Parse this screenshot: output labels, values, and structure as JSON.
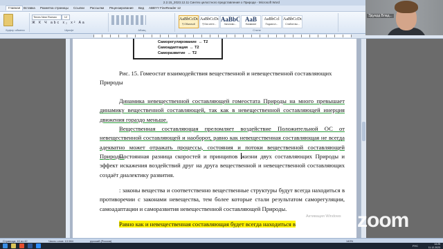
{
  "window": {
    "title": "2.2.15_2023.12.11 Синтез целостного представления о Природе - Microsoft Word",
    "controls": "— □ ✕"
  },
  "tabs": [
    "Главная",
    "Вставка",
    "Разметка страницы",
    "Ссылки",
    "Рассылки",
    "Рецензирование",
    "Вид",
    "ABBYY FineReader 12"
  ],
  "ribbon": {
    "font_name": "Times New Roman",
    "font_size": "12",
    "format_buttons": "Ж К Ч abc x₂ x² Aa",
    "groups": [
      "Буфер обмена",
      "Шрифт",
      "Абзац",
      "Стили",
      "Редактирование"
    ],
    "styles": [
      {
        "sample": "AaBbCcDc",
        "name": "¶ Обычный"
      },
      {
        "sample": "AaBbCcDc",
        "name": "¶ Без инте..."
      },
      {
        "sample": "AaBbC",
        "name": "Заголово..."
      },
      {
        "sample": "AaB",
        "name": "Название"
      },
      {
        "sample": "AaBbCcl",
        "name": "Подзагол..."
      },
      {
        "sample": "AaBbCcDc",
        "name": "Слабое вы..."
      }
    ],
    "edit_items": [
      "Найти ▾",
      "Заменить",
      "Выделить ▾"
    ]
  },
  "figure": {
    "rows": [
      {
        "label": "Саморегулирование",
        "arrow": "↔",
        "code": "Т2"
      },
      {
        "label": "Самоадаптация",
        "arrow": "↔",
        "code": "Т2"
      },
      {
        "label": "Саморазвитие",
        "arrow": "↔",
        "code": "Т2"
      }
    ]
  },
  "document": {
    "caption": "Рис. 15. Гомеостат взаимодействия вещественной и невещественной составляющих Природы",
    "p1": "Динамика невещественной составляющей гомеостата Природы на много превышает динамику вещественной составляющей, так как в невещественной составляющей инерция движения гораздо меньше.",
    "p2": "Вещественная составляющая преломляет воздействие Положительной ОС от невещественной составляющей и наоборот, равно как невещественная составляющая не всегда адекватно может отражать процессы, состояния и потоки вещественной составляющей Природы.",
    "p3_before": "Постоянная разница скоростей и принципов ",
    "p3_after": "жизни двух составляющих Природы и эффект искажения воздействий друг на друга вещественной и невещественной составляющих создаёт диалектику развития.",
    "p4": ": законы вещества и соответственно вещественные структуры будут всегда находиться в противоречии с законами невещества, тем более которые стали результатом саморегуляции, самоадаптации и саморазвития невещественной составляющей Природы.",
    "p5": "Равно как и невещественная составляющая будет всегда находиться в"
  },
  "status_bar": {
    "page": "Страница: 40 из 42",
    "words": "Число слов: 13 084",
    "language": "русский (Россия)",
    "zoom": "140%"
  },
  "taskbar": {
    "language": "РУС",
    "time": "14:25",
    "date": "11.12.2023"
  },
  "overlays": {
    "activation_title": "Активация Windows",
    "activation_hint": "Чтобы активировать Windows, перейдите в раздел \"Параметры\".",
    "zoom_logo": "zoom",
    "participant_name": "Эдуард Влад..."
  }
}
